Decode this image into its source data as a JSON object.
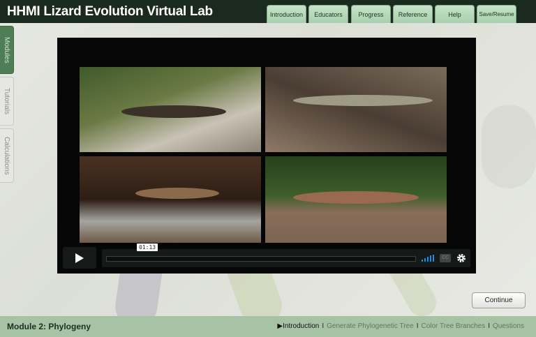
{
  "header": {
    "title": "HHMI Lizard Evolution Virtual Lab",
    "tabs": [
      "Introduction",
      "Educators",
      "Progress",
      "Reference",
      "Help",
      "Save/Resume"
    ]
  },
  "sidebar": {
    "tabs": [
      {
        "label": "Modules",
        "active": true
      },
      {
        "label": "Tutorials",
        "active": false
      },
      {
        "label": "Calculations",
        "active": false
      }
    ]
  },
  "video": {
    "current_time": "01:13",
    "icons": [
      "play-icon",
      "volume-icon",
      "closed-captions-icon",
      "settings-gear-icon"
    ],
    "accent": "#1a8fe0"
  },
  "continue_label": "Continue",
  "footer": {
    "module_title": "Module 2: Phylogeny",
    "steps": [
      {
        "label": "Introduction",
        "current": true
      },
      {
        "label": "Generate Phylogenetic Tree"
      },
      {
        "label": "Color Tree Branches"
      },
      {
        "label": "Questions"
      }
    ],
    "separator": "I",
    "current_marker": "▶"
  }
}
